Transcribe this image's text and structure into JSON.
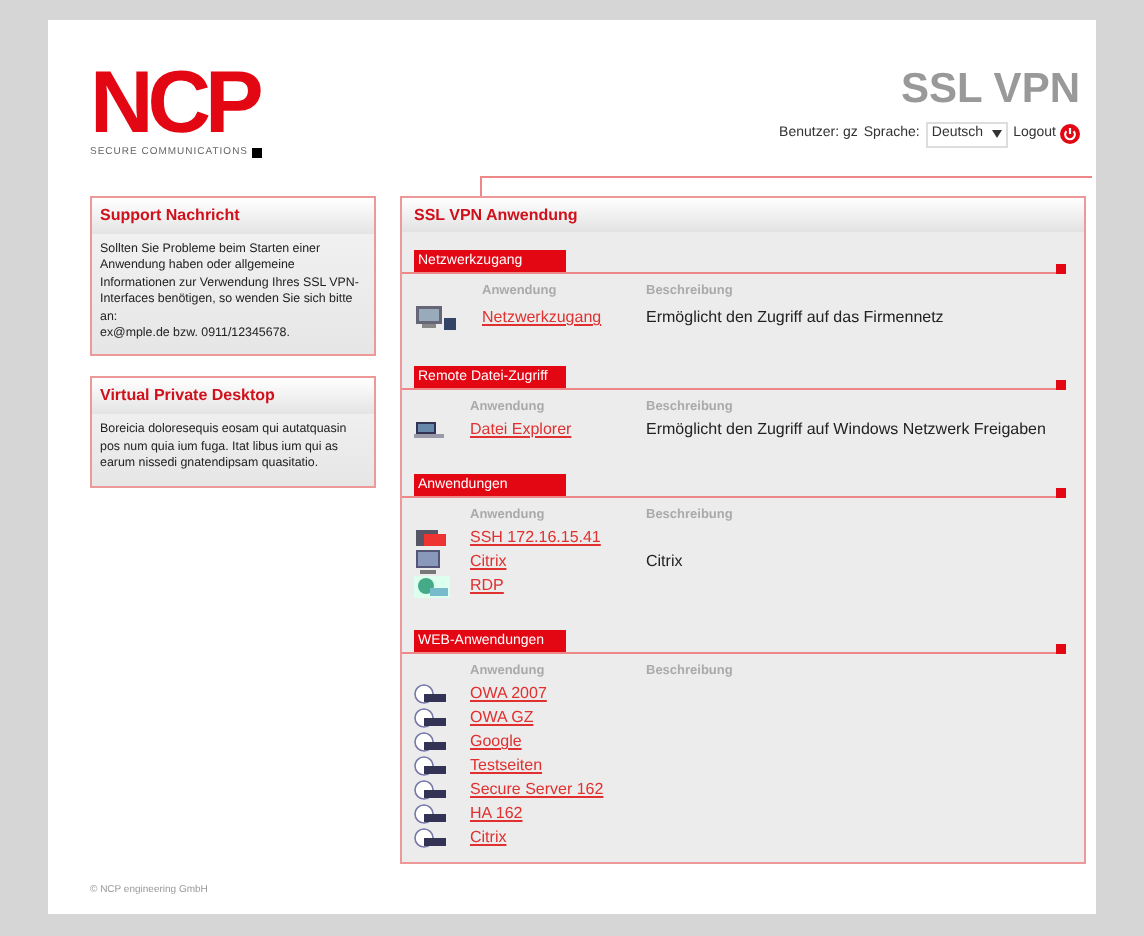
{
  "header": {
    "logo": "NCP",
    "tagline": "SECURE COMMUNICATIONS",
    "title": "SSL VPN",
    "user_label": "Benutzer: gz",
    "language_label": "Sprache:",
    "language": "Deutsch",
    "logout": "Logout"
  },
  "sidebar": [
    {
      "title": "Support Nachricht",
      "text": "Sollten Sie Probleme beim Starten einer Anwendung haben oder allgemeine Informationen zur Verwendung Ihres SSL VPN-Interfaces benötigen, so wenden Sie sich bitte an:",
      "contact": "ex@mple.de bzw. 0911/12345678."
    },
    {
      "title": "Virtual Private Desktop",
      "text": "Boreicia doloresequis eosam qui autatquasin pos num quia ium fuga. Itat libus ium qui as earum nissedi gnatendipsam quasitatio."
    }
  ],
  "main": {
    "title": "SSL VPN Anwendung",
    "sections": [
      {
        "title": "Netzwerkzugang",
        "columns": [
          "Anwendung",
          "Beschreibung"
        ],
        "rows": [
          {
            "kind": "network",
            "name": "Netzwerkzugang",
            "description": "Ermöglicht den Zugriff auf das Firmennetz"
          }
        ]
      },
      {
        "title": "Remote Datei-Zugriff",
        "columns": [
          "Anwendung",
          "Beschreibung"
        ],
        "rows": [
          {
            "kind": "explorer",
            "name": "Datei Explorer",
            "description": "Ermöglicht den Zugriff auf Windows Netzwerk Freigaben"
          }
        ]
      },
      {
        "title": "Anwendungen",
        "columns": [
          "Anwendung",
          "Beschreibung"
        ],
        "rows": [
          {
            "kind": "ssh",
            "name": "SSH 172.16.15.41"
          },
          {
            "kind": "citrix",
            "name": "Citrix",
            "description": "Citrix"
          },
          {
            "kind": "rdp",
            "name": "RDP"
          }
        ]
      },
      {
        "title": "WEB-Anwendungen",
        "columns": [
          "Anwendung",
          "Beschreibung"
        ],
        "rows": [
          {
            "kind": "web",
            "name": "OWA 2007"
          },
          {
            "kind": "web",
            "name": "OWA GZ"
          },
          {
            "kind": "web",
            "name": "Google"
          },
          {
            "kind": "web",
            "name": "Testseiten"
          },
          {
            "kind": "web",
            "name": "Secure Server 162"
          },
          {
            "kind": "web",
            "name": "HA 162"
          },
          {
            "kind": "web",
            "name": "Citrix"
          }
        ]
      }
    ]
  },
  "footer": "© NCP engineering GmbH"
}
